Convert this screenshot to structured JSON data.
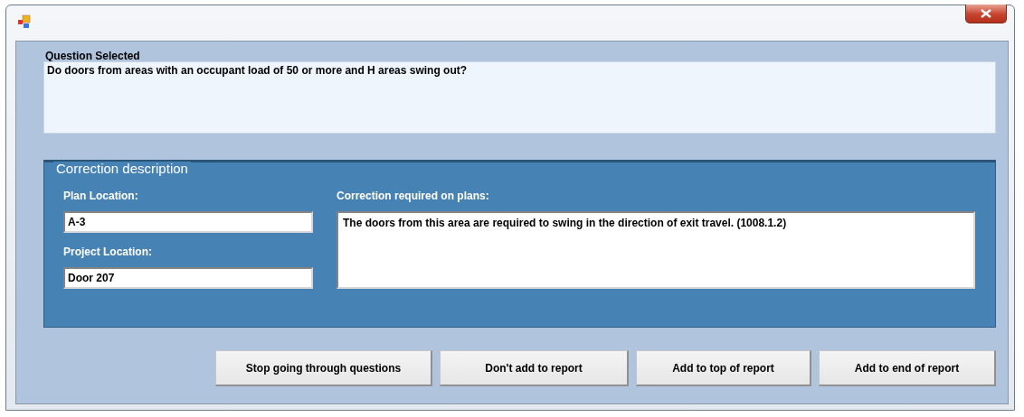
{
  "question": {
    "label": "Question Selected",
    "text": "Do doors from areas with an occupant load of 50 or more and H areas swing out?"
  },
  "correction": {
    "title": "Correction description",
    "plan_location": {
      "label": "Plan Location:",
      "value": "A-3"
    },
    "project_location": {
      "label": "Project Location:",
      "value": "Door 207"
    },
    "correction_required": {
      "label": "Correction required on plans:",
      "value": "The doors from this area are required to swing in the direction of exit travel. (1008.1.2)"
    }
  },
  "buttons": [
    "Stop going through questions",
    "Don't add to report",
    "Add to top of report",
    "Add to end of report"
  ]
}
